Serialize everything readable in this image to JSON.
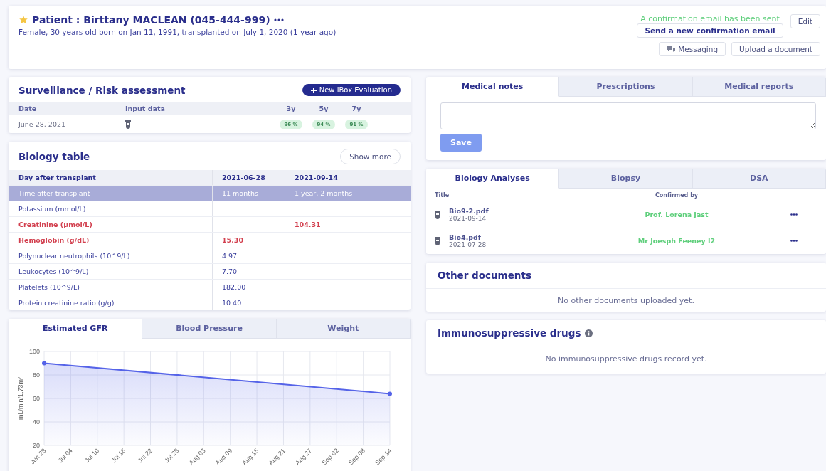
{
  "patient": {
    "starred": true,
    "title": "Patient : Birttany MACLEAN (045-444-999)",
    "subtitle": "Female, 30 years old born on Jan 11, 1991, transplanted on July 1, 2020 (1 year ago)",
    "email_status": "A confirmation email has been sent",
    "buttons": {
      "edit": "Edit",
      "resend": "Send a new confirmation email",
      "messaging": "Messaging",
      "upload": "Upload a document"
    }
  },
  "surveillance": {
    "title": "Surveillance / Risk assessment",
    "new_button": "New iBox Evaluation",
    "columns": [
      "Date",
      "Input data",
      "3y",
      "5y",
      "7y"
    ],
    "rows": [
      {
        "date": "June 28, 2021",
        "scores": [
          "96 %",
          "94 %",
          "91 %"
        ]
      }
    ]
  },
  "biology_table": {
    "title": "Biology table",
    "show_more": "Show more",
    "columns": [
      "Day after transplant",
      "2021-06-28",
      "2021-09-14"
    ],
    "rows": [
      {
        "kind": "subheader",
        "alert": false,
        "cells": [
          "Time after transplant",
          "11 months",
          "1 year, 2 months"
        ]
      },
      {
        "kind": "value",
        "alert": false,
        "cells": [
          "Potassium (mmol/L)",
          "",
          ""
        ]
      },
      {
        "kind": "value",
        "alert": true,
        "cells": [
          "Creatinine (µmol/L)",
          "",
          "104.31"
        ]
      },
      {
        "kind": "value",
        "alert": true,
        "cells": [
          "Hemoglobin (g/dL)",
          "15.30",
          ""
        ]
      },
      {
        "kind": "value",
        "alert": false,
        "cells": [
          "Polynuclear neutrophils (10^9/L)",
          "4.97",
          ""
        ]
      },
      {
        "kind": "value",
        "alert": false,
        "cells": [
          "Leukocytes (10^9/L)",
          "7.70",
          ""
        ]
      },
      {
        "kind": "value",
        "alert": false,
        "cells": [
          "Platelets (10^9/L)",
          "182.00",
          ""
        ]
      },
      {
        "kind": "value",
        "alert": false,
        "cells": [
          "Protein creatinine ratio (g/g)",
          "10.40",
          ""
        ]
      }
    ]
  },
  "chart_tabs": [
    {
      "label": "Estimated GFR",
      "selected": true
    },
    {
      "label": "Blood Pressure",
      "selected": false
    },
    {
      "label": "Weight",
      "selected": false
    }
  ],
  "gfr_chart": {
    "chart_data": {
      "type": "area",
      "ylabel": "mL/min/1,73m²",
      "categories": [
        "Jun 28",
        "Jul 04",
        "Jul 10",
        "Jul 16",
        "Jul 22",
        "Jul 28",
        "Aug 03",
        "Aug 09",
        "Aug 15",
        "Aug 21",
        "Aug 27",
        "Sep 02",
        "Sep 08",
        "Sep 14"
      ],
      "series": [
        {
          "color": "#5563e8",
          "values": [
            90,
            null,
            null,
            null,
            null,
            null,
            null,
            null,
            null,
            null,
            null,
            null,
            null,
            64
          ]
        }
      ],
      "ylim": [
        20,
        100
      ],
      "yticks": [
        20,
        40,
        60,
        80,
        100
      ],
      "grid": true
    }
  },
  "notes_tabs": [
    {
      "label": "Medical notes",
      "selected": true
    },
    {
      "label": "Prescriptions",
      "selected": false
    },
    {
      "label": "Medical reports",
      "selected": false
    }
  ],
  "notes": {
    "save": "Save",
    "save_disabled": true
  },
  "analysis_tabs": [
    {
      "label": "Biology Analyses",
      "selected": true
    },
    {
      "label": "Biopsy",
      "selected": false
    },
    {
      "label": "DSA",
      "selected": false
    }
  ],
  "analyses": {
    "columns": [
      "Title",
      "Confirmed by"
    ],
    "rows": [
      {
        "title": "Bio9-2.pdf",
        "date": "2021-09-14",
        "confirmed_by": "Prof. Lorena Jast"
      },
      {
        "title": "Bio4.pdf",
        "date": "2021-07-28",
        "confirmed_by": "Mr Joesph Feeney I2"
      }
    ]
  },
  "other_documents": {
    "title": "Other documents",
    "empty": "No other documents uploaded yet."
  },
  "immunosuppressive": {
    "title": "Immunosuppressive drugs",
    "empty": "No immunosuppressive drugs record yet."
  }
}
